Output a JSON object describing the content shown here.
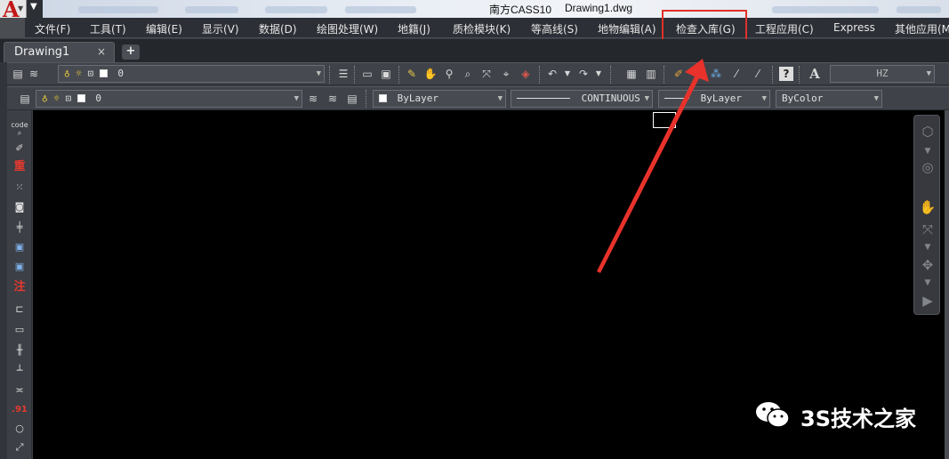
{
  "window": {
    "app_title": "南方CASS10",
    "doc_title": "Drawing1.dwg"
  },
  "menubar": {
    "items": [
      {
        "id": "file",
        "label": "文件(F)"
      },
      {
        "id": "tools",
        "label": "工具(T)"
      },
      {
        "id": "edit",
        "label": "编辑(E)"
      },
      {
        "id": "display",
        "label": "显示(V)"
      },
      {
        "id": "data",
        "label": "数据(D)"
      },
      {
        "id": "draw",
        "label": "绘图处理(W)"
      },
      {
        "id": "cadastre",
        "label": "地籍(J)"
      },
      {
        "id": "qc",
        "label": "质检模块(K)"
      },
      {
        "id": "contour",
        "label": "等高线(S)"
      },
      {
        "id": "feature",
        "label": "地物编辑(A)"
      },
      {
        "id": "check",
        "label": "检查入库(G)"
      },
      {
        "id": "engineering",
        "label": "工程应用(C)"
      },
      {
        "id": "express",
        "label": "Express"
      },
      {
        "id": "other",
        "label": "其他应用(M"
      }
    ]
  },
  "tabs": {
    "document": "Drawing1",
    "close_glyph": "×",
    "new_glyph": "+"
  },
  "toolbar1": {
    "layer_value": "0",
    "text_style_icon": "A",
    "text_style_value": "HZ"
  },
  "toolbar2": {
    "layer_value": "0",
    "color_value": "ByLayer",
    "linetype_value": "CONTINUOUS",
    "lineweight_value": "ByLayer",
    "plotstyle_value": "ByColor"
  },
  "lefttools": {
    "code_label": "code",
    "redraw_label": "重",
    "annotate_label": "注",
    "dim_label": ".91"
  },
  "watermark": {
    "text": "3S技术之家"
  },
  "colors": {
    "menubar_bg": "#2c2f35",
    "canvas_bg": "#000000",
    "highlight": "#e0302a",
    "titlebar_bg": "#dfe6f0"
  },
  "icons": [
    "layer-manager-icon",
    "bulb-icon",
    "sun-icon",
    "lock-icon",
    "save-icon",
    "open-icon",
    "pan-icon",
    "zoom-icon",
    "undo-icon",
    "redo-icon",
    "help-icon",
    "orbit-icon",
    "steering-wheel-icon",
    "showmotion-icon"
  ]
}
